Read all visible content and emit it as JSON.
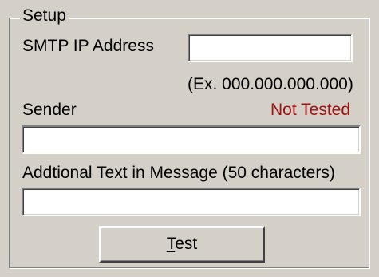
{
  "setup": {
    "title": "Setup",
    "smtp": {
      "label": "SMTP IP Address",
      "value": "",
      "hint": "(Ex. 000.000.000.000)"
    },
    "sender": {
      "label": "Sender",
      "status": "Not Tested",
      "value": ""
    },
    "additional_text": {
      "label": "Addtional Text in Message (50 characters)",
      "value": ""
    },
    "test_button": {
      "mnemonic": "T",
      "rest": "est"
    }
  },
  "colors": {
    "dialog_background": "#d4d0c8",
    "status_text": "#a01010"
  }
}
